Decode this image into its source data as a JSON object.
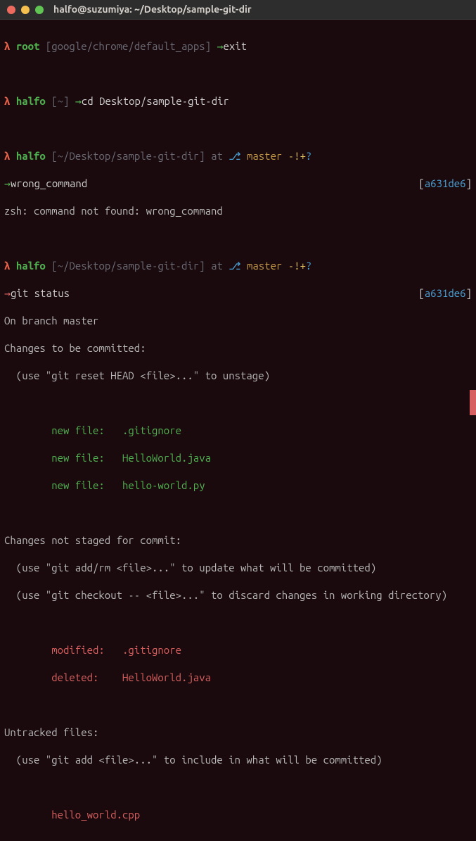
{
  "window": {
    "title": "halfo@suzumiya: ~/Desktop/sample-git-dir"
  },
  "prompts": [
    {
      "lambda": "λ",
      "user": "root",
      "path": "google/chrome/default_apps",
      "arrow": "→",
      "command": "exit",
      "arrow_err": false
    },
    {
      "lambda": "λ",
      "user": "halfo",
      "path": "~",
      "arrow": "→",
      "command": "cd Desktop/sample-git-dir",
      "arrow_err": false
    },
    {
      "lambda": "λ",
      "user": "halfo",
      "path": "~/Desktop/sample-git-dir",
      "at": "at",
      "git_glyph": "⎇",
      "git_branch": "master",
      "git_flag_tracked": "-!+",
      "git_flag_untracked": "?",
      "arrow": "→",
      "command": "wrong_command",
      "hash": "a631de6",
      "arrow_err": false
    },
    {
      "error": "zsh: command not found: wrong_command"
    },
    {
      "lambda": "λ",
      "user": "halfo",
      "path": "~/Desktop/sample-git-dir",
      "at": "at",
      "git_glyph": "⎇",
      "git_branch": "master",
      "git_flag_tracked": "-!+",
      "git_flag_untracked": "?",
      "arrow": "→",
      "command": "git status",
      "hash": "a631de6",
      "arrow_err": true
    }
  ],
  "gitstatus": {
    "branch_line": "On branch master",
    "committed_header": "Changes to be committed:",
    "committed_hint": "  (use \"git reset HEAD <file>...\" to unstage)",
    "new_files": [
      "        new file:   .gitignore",
      "        new file:   HelloWorld.java",
      "        new file:   hello-world.py"
    ],
    "notstaged_header": "Changes not staged for commit:",
    "notstaged_hint1": "  (use \"git add/rm <file>...\" to update what will be committed)",
    "notstaged_hint2": "  (use \"git checkout -- <file>...\" to discard changes in working directory)",
    "modified": [
      "        modified:   .gitignore",
      "        deleted:    HelloWorld.java"
    ],
    "untracked_header": "Untracked files:",
    "untracked_hint": "  (use \"git add <file>...\" to include in what will be committed)",
    "untracked": [
      "        hello_world.cpp"
    ]
  }
}
